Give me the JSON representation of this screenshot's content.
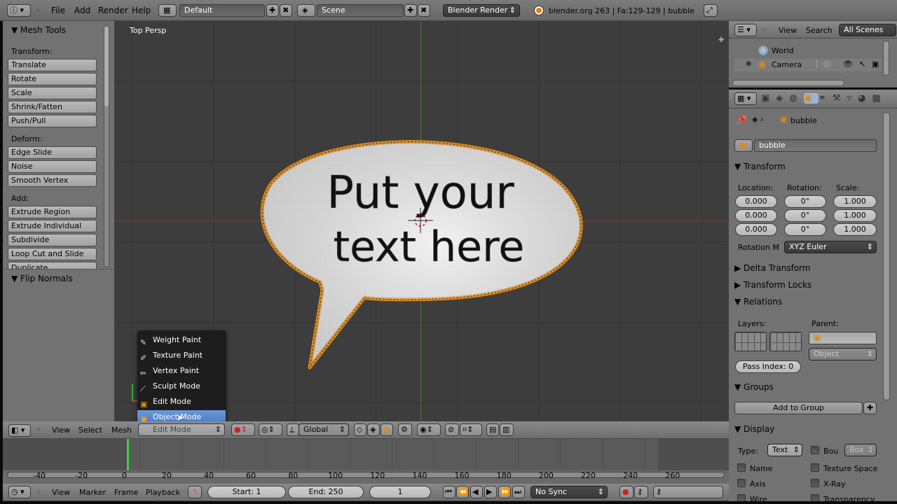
{
  "top_menu": {
    "file": "File",
    "add": "Add",
    "render": "Render",
    "help": "Help",
    "layout": "Default",
    "scene": "Scene",
    "engine": "Blender Render",
    "stats": "blender.org 263 | Fa:129-129 | bubble"
  },
  "tool_shelf": {
    "title": "Mesh Tools",
    "transform_label": "Transform:",
    "transform": [
      "Translate",
      "Rotate",
      "Scale",
      "Shrink/Fatten",
      "Push/Pull"
    ],
    "deform_label": "Deform:",
    "deform": [
      "Edge Slide",
      "Noise",
      "Smooth Vertex"
    ],
    "add_label": "Add:",
    "add": [
      "Extrude Region",
      "Extrude Individual",
      "Subdivide",
      "Loop Cut and Slide",
      "Duplicate"
    ],
    "flip_normals": "Flip Normals"
  },
  "viewport": {
    "label": "Top Persp",
    "bubble_line1": "Put your",
    "bubble_line2": "text here"
  },
  "mode_menu": {
    "items": [
      "Weight Paint",
      "Texture Paint",
      "Vertex Paint",
      "Sculpt Mode",
      "Edit Mode",
      "Object Mode"
    ],
    "selected": "Object Mode"
  },
  "view_header": {
    "view": "View",
    "select": "Select",
    "mesh": "Mesh",
    "mode": "Edit Mode",
    "orientation": "Global"
  },
  "timeline": {
    "ticks": [
      "-40",
      "-20",
      "0",
      "20",
      "40",
      "60",
      "80",
      "100",
      "120",
      "140",
      "160",
      "180",
      "200",
      "220",
      "240",
      "260"
    ],
    "view": "View",
    "marker": "Marker",
    "frame": "Frame",
    "playback": "Playback",
    "start": "Start: 1",
    "end": "End: 250",
    "current": "1",
    "sync": "No Sync"
  },
  "outliner": {
    "view": "View",
    "search": "Search",
    "filter": "All Scenes",
    "items": [
      "World",
      "Camera"
    ]
  },
  "properties": {
    "breadcrumb": "bubble",
    "object_name": "bubble",
    "transform_title": "Transform",
    "location_label": "Location:",
    "rotation_label": "Rotation:",
    "scale_label": "Scale:",
    "location": [
      "0.000",
      "0.000",
      "0.000"
    ],
    "rotation": [
      "0°",
      "0°",
      "0°"
    ],
    "scale": [
      "1.000",
      "1.000",
      "1.000"
    ],
    "rotation_mode_label": "Rotation M",
    "rotation_mode": "XYZ Euler",
    "delta_transform": "Delta Transform",
    "transform_locks": "Transform Locks",
    "relations": "Relations",
    "layers_label": "Layers:",
    "parent_label": "Parent:",
    "parent_type": "Object",
    "pass_index": "Pass Index: 0",
    "groups": "Groups",
    "add_to_group": "Add to Group",
    "display": "Display",
    "type_label": "Type:",
    "type_value": "Text",
    "bounds_label": "Bou",
    "bounds_value": "Box",
    "checks": [
      "Name",
      "Axis",
      "Wire",
      "Texture Space",
      "X-Ray",
      "Transparency"
    ]
  }
}
